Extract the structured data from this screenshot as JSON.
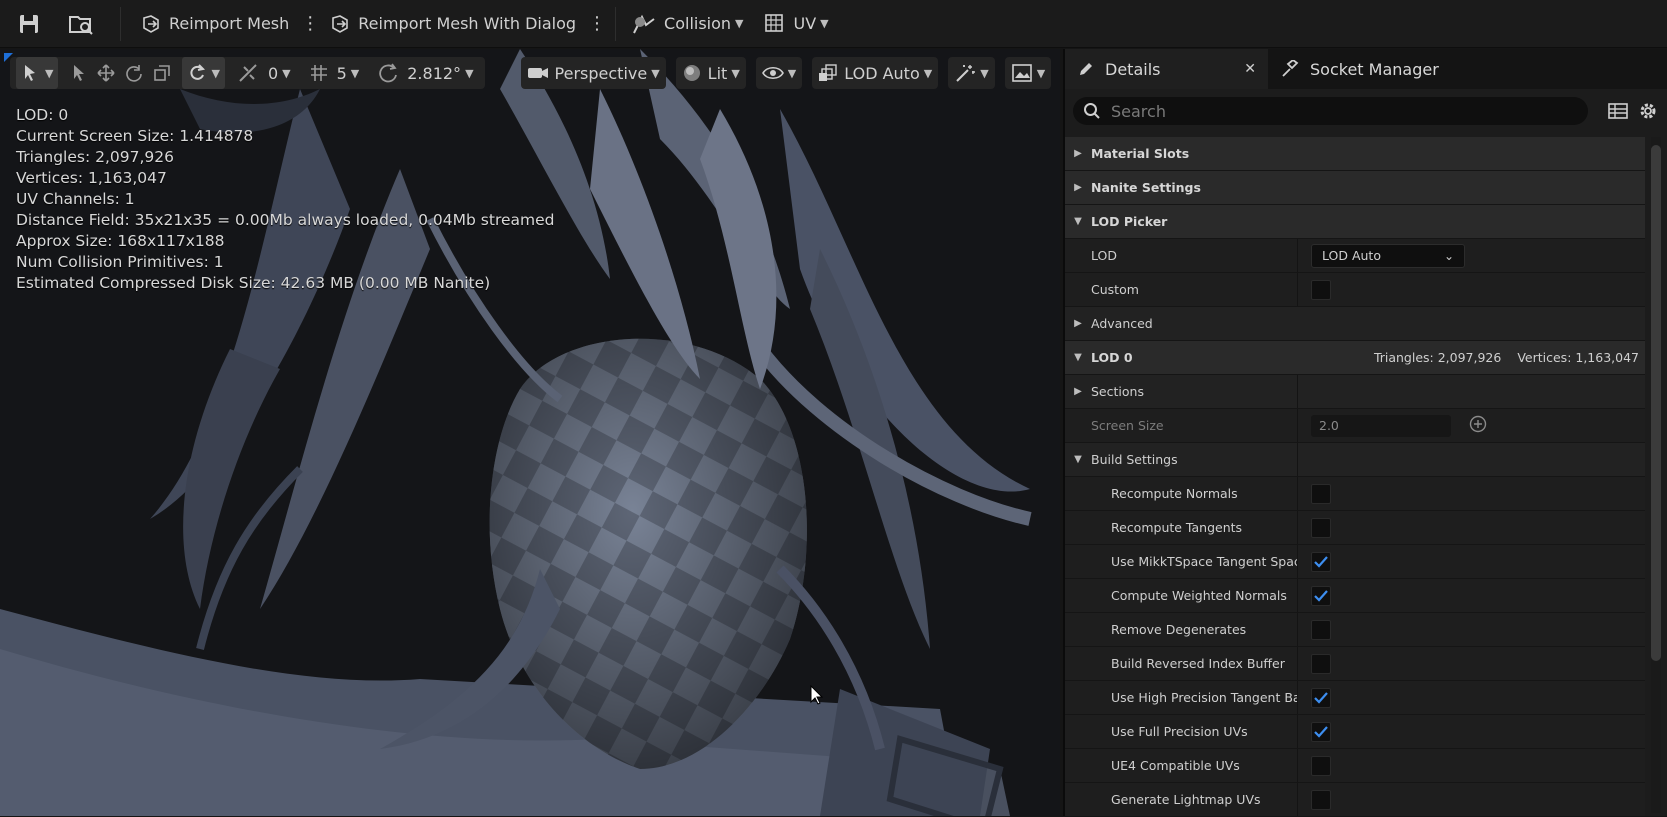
{
  "toolbar": {
    "reimport": "Reimport Mesh",
    "reimport_dialog": "Reimport Mesh With Dialog",
    "collision": "Collision",
    "uv": "UV"
  },
  "viewport": {
    "snap_angle_count": "0",
    "grid_size": "5",
    "rotation_snap": "2.812°",
    "view_mode": "Perspective",
    "lighting": "Lit",
    "lod": "LOD Auto",
    "stats": [
      "LOD:  0",
      "Current Screen Size:  1.414878",
      "Triangles:  2,097,926",
      "Vertices:  1,163,047",
      "UV Channels:  1",
      "Distance Field:  35x21x35 = 0.00Mb always loaded, 0.04Mb streamed",
      "Approx Size: 168x117x188",
      "Num Collision Primitives:  1",
      "Estimated Compressed Disk Size: 42.63 MB (0.00 MB Nanite)"
    ]
  },
  "panel": {
    "tab_details": "Details",
    "tab_socket": "Socket Manager",
    "search_placeholder": "Search",
    "material_slots": "Material Slots",
    "nanite_settings": "Nanite Settings",
    "lod_picker": "LOD Picker",
    "lod_label": "LOD",
    "lod_value": "LOD Auto",
    "custom": "Custom",
    "advanced": "Advanced",
    "lod0": "LOD 0",
    "lod0_triangles": "Triangles: 2,097,926",
    "lod0_vertices": "Vertices: 1,163,047",
    "sections": "Sections",
    "screen_size": "Screen Size",
    "screen_size_value": "2.0",
    "build_settings": "Build Settings",
    "build_props": [
      {
        "label": "Recompute Normals",
        "checked": false
      },
      {
        "label": "Recompute Tangents",
        "checked": false
      },
      {
        "label": "Use MikkTSpace Tangent Space",
        "checked": true
      },
      {
        "label": "Compute Weighted Normals",
        "checked": true
      },
      {
        "label": "Remove Degenerates",
        "checked": false
      },
      {
        "label": "Build Reversed Index Buffer",
        "checked": false
      },
      {
        "label": "Use High Precision Tangent Basis",
        "checked": true
      },
      {
        "label": "Use Full Precision UVs",
        "checked": true
      },
      {
        "label": "UE4 Compatible UVs",
        "checked": false
      },
      {
        "label": "Generate Lightmap UVs",
        "checked": false
      }
    ]
  },
  "colors": {
    "accent": "#1e6fd9",
    "check": "#3d8ef0"
  }
}
